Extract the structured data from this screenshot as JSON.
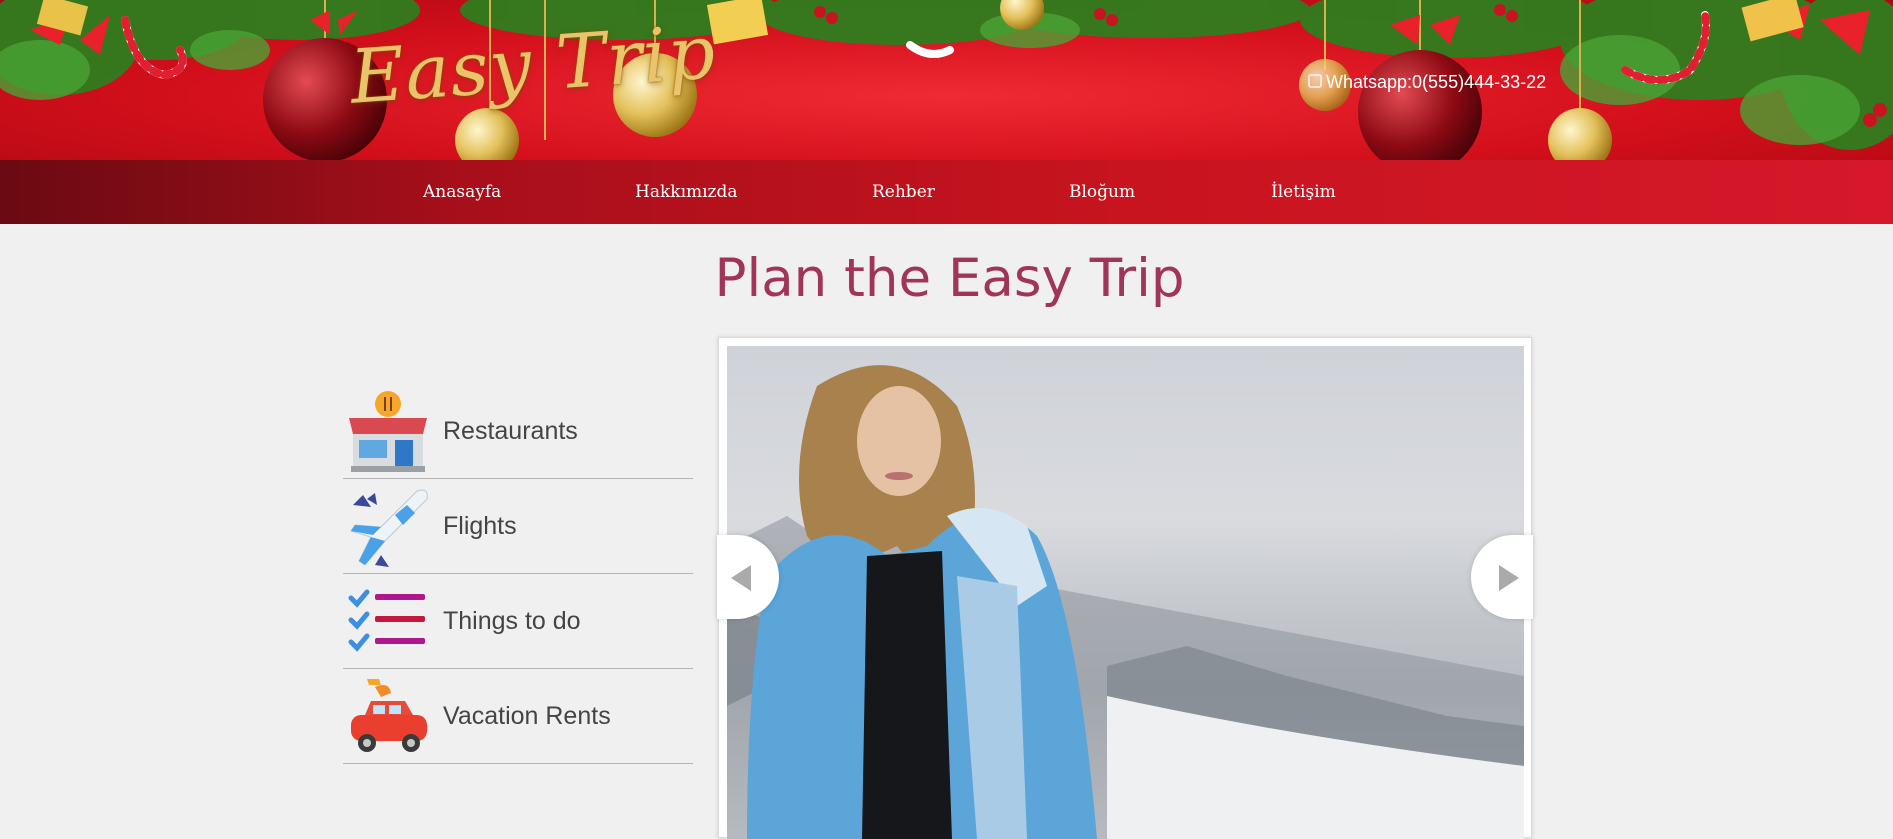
{
  "header": {
    "logo_text": "Easy Trip",
    "whatsapp": "Whatsapp:0(555)444-33-22",
    "colors": {
      "banner": "#d4101c",
      "logo": "#e9c46a",
      "nav_dark": "#6a0a12",
      "nav_light": "#d6182a"
    }
  },
  "nav": {
    "items": [
      {
        "label": "Anasayfa"
      },
      {
        "label": "Hakkımızda"
      },
      {
        "label": "Rehber"
      },
      {
        "label": "Bloğum"
      },
      {
        "label": "İletişim"
      }
    ]
  },
  "main": {
    "title": "Plan the Easy Trip",
    "title_color": "#a0345a",
    "services": [
      {
        "label": "Restaurants",
        "icon": "restaurant-icon"
      },
      {
        "label": "Flights",
        "icon": "airplane-icon"
      },
      {
        "label": "Things to do",
        "icon": "checklist-icon"
      },
      {
        "label": "Vacation Rents",
        "icon": "car-icon"
      }
    ],
    "slider": {
      "image": "woman-in-blue-ski-jacket-snowy-mountain-photo",
      "prev_icon": "chevron-left-icon",
      "next_icon": "chevron-right-icon"
    }
  }
}
